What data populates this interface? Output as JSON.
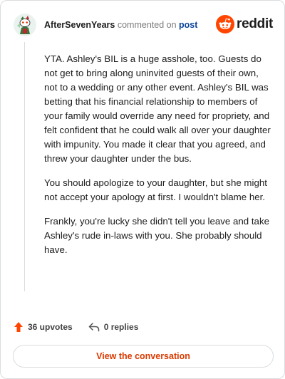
{
  "comment": {
    "username": "AfterSevenYears",
    "action_text": " commented on ",
    "post_link_label": "post",
    "paragraphs": [
      "YTA. Ashley's BIL is a huge asshole, too. Guests do not get to bring along uninvited guests of their own, not to a wedding or any other event. Ashley's BIL was betting that his financial relationship to members of your family would override any need for propriety, and felt confident that he could walk all over your daughter with impunity. You made it clear that you agreed, and threw your daughter under the bus.",
      "You should apologize to your daughter, but she might not accept your apology at first. I wouldn't blame her.",
      "Frankly, you're lucky she didn't tell you leave and take Ashley's rude in-laws with you. She probably should have."
    ]
  },
  "brand": {
    "name": "reddit",
    "icon": "reddit-snoo-icon",
    "color": "#ff4500"
  },
  "avatar": {
    "icon": "snoo-avatar-icon"
  },
  "actions": {
    "upvotes_label": "36 upvotes",
    "upvote_icon": "upvote-arrow-icon",
    "upvote_color": "#ff4500",
    "replies_label": "0 replies",
    "reply_icon": "reply-arrow-icon"
  },
  "footer": {
    "view_conversation_label": "View the conversation",
    "accent_color": "#d93a00"
  }
}
